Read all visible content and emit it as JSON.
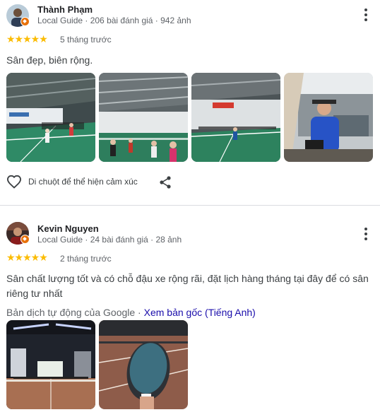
{
  "reviews": [
    {
      "author": "Thành Phạm",
      "meta": "Local Guide · 206 bài đánh giá · 942 ảnh",
      "rating": 5,
      "stars": "★★★★★",
      "date": "5 tháng trước",
      "text": "Sân đẹp, biên rộng.",
      "reaction_label": "Di chuột để thể hiện cảm xúc",
      "photos": [
        "court-photo-1",
        "court-photo-2",
        "court-photo-3",
        "player-photo-4"
      ]
    },
    {
      "author": "Kevin Nguyen",
      "meta": "Local Guide · 24 bài đánh giá · 28 ảnh",
      "rating": 5,
      "stars": "★★★★★",
      "date": "2 tháng trước",
      "text": "Sân chất lượng tốt và có chỗ đậu xe rộng rãi, đặt lịch hàng tháng tại đây để có sân riêng tư nhất",
      "translation_note": "Bản dịch tự động của Google · ",
      "translation_link": "Xem bản gốc (Tiếng Anh)",
      "photos": [
        "indoor-court-photo",
        "paddle-photo"
      ]
    }
  ],
  "colors": {
    "star": "#fbbc04",
    "link": "#1a0dab",
    "badge": "#e8710a"
  }
}
